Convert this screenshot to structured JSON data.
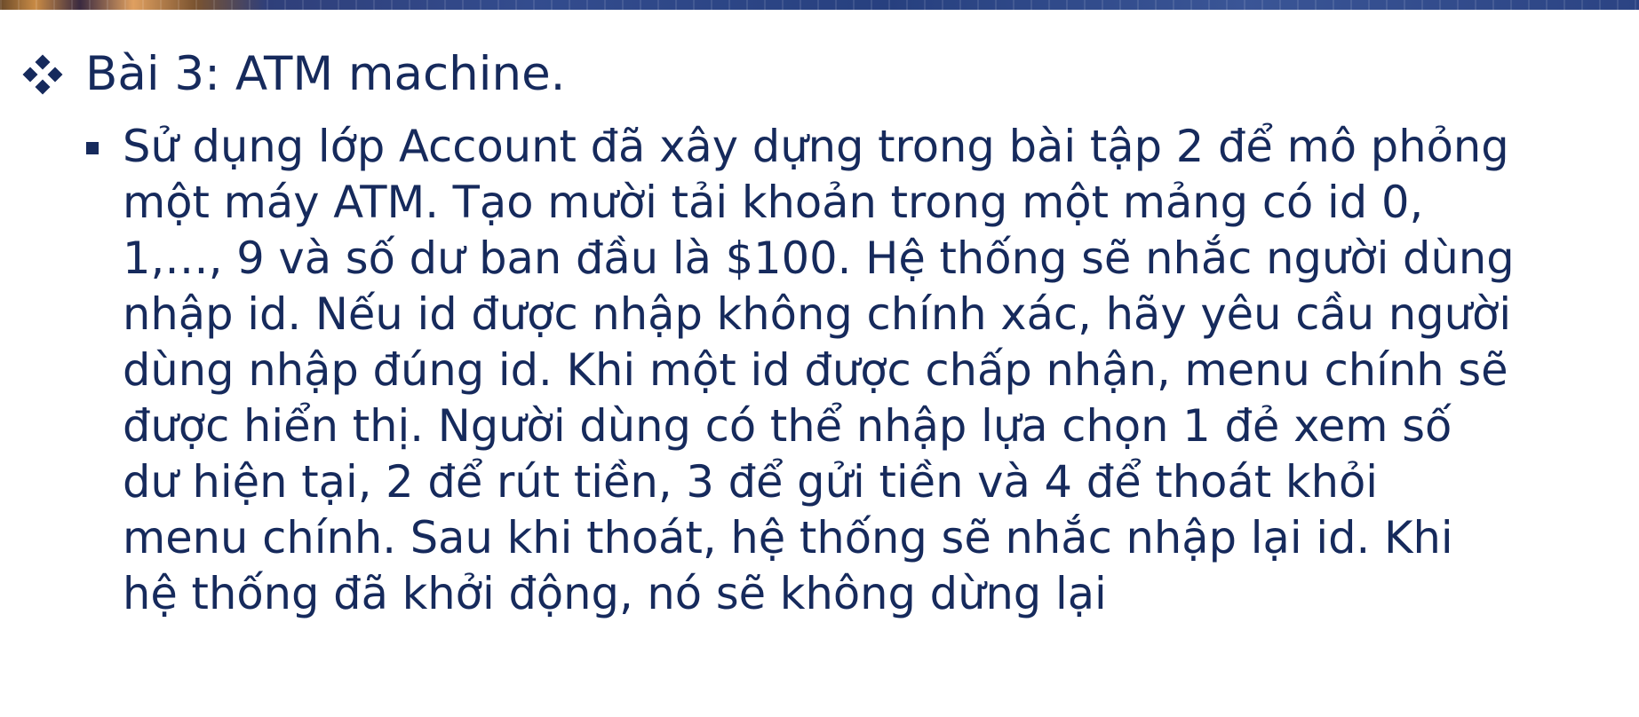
{
  "slide": {
    "heading": "Bài 3: ATM machine.",
    "body_lines": [
      "Sử dụng lớp Account đã xây dựng trong bài tập 2 để mô phỏng",
      "một máy ATM. Tạo mười tải khoản trong một mảng có id 0,",
      "1,…, 9 và số dư ban đầu là $100. Hệ thống sẽ nhắc người dùng",
      "nhập id. Nếu id được nhập không chính xác, hãy yêu cầu người",
      "dùng nhập đúng id. Khi một id được chấp nhận, menu chính sẽ",
      "được hiển thị. Người dùng có thể nhập lựa chọn 1 đẻ xem số",
      "dư hiện tại, 2 để rút tiền, 3 để gửi tiền và 4 để thoát khỏi",
      "menu chính. Sau khi thoát, hệ thống sẽ nhắc nhập lại id. Khi",
      "hệ thống đã khởi động, nó sẽ không dừng lại"
    ],
    "colors": {
      "text": "#162a5c",
      "background": "#ffffff"
    },
    "icons": {
      "heading_bullet": "four-diamond-bullet-icon",
      "item_bullet": "square-bullet-icon"
    }
  }
}
